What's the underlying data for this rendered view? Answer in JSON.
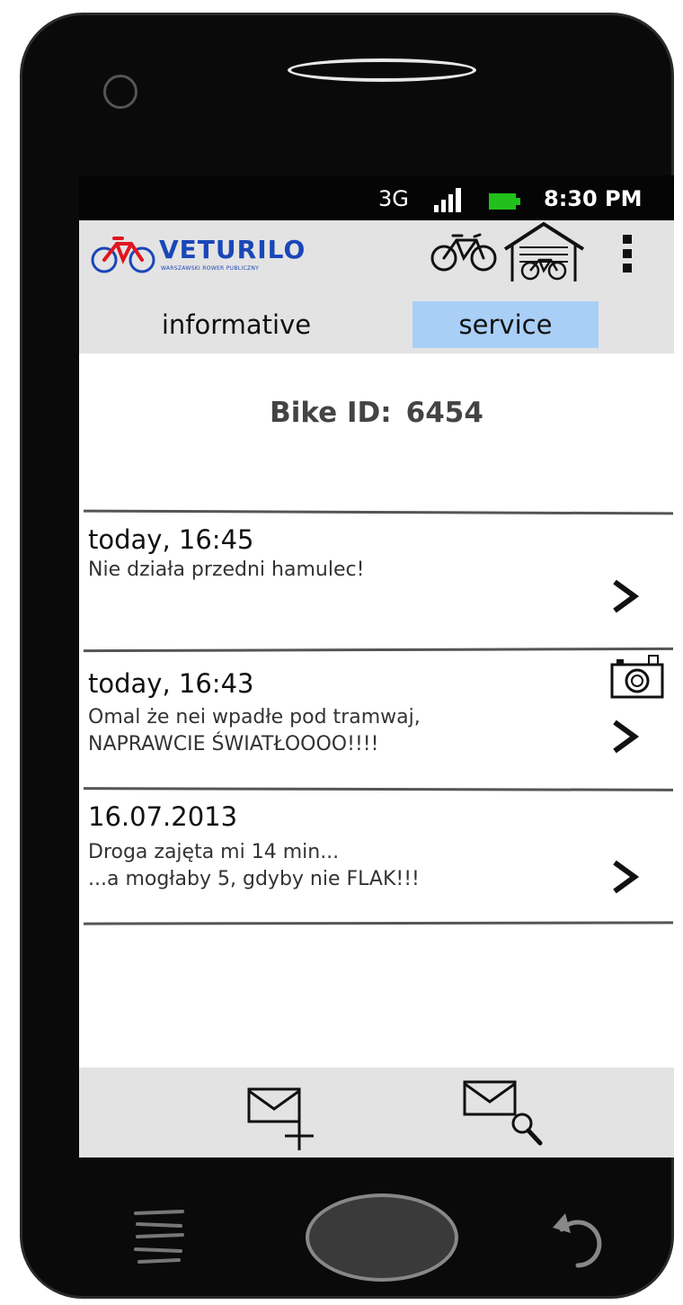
{
  "statusbar": {
    "network": "3G",
    "time": "8:30 PM",
    "battery_color": "#22c01a"
  },
  "appbar": {
    "brand": "VETURILO",
    "brand_sub": "WARSZAWSKI ROWER PUBLICZNY",
    "brand_color": "#1a46b8",
    "bike_icon": "bicycle-icon",
    "garage_icon": "garage-icon",
    "menu_icon": "overflow-menu-icon"
  },
  "tabs": [
    {
      "label": "informative",
      "active": false
    },
    {
      "label": "service",
      "active": true,
      "active_color": "#a9cff7"
    }
  ],
  "bike": {
    "label": "Bike ID:",
    "id": "6454"
  },
  "reports": [
    {
      "date": "today, 16:45",
      "message": "Nie działa przedni hamulec!",
      "has_photo": false
    },
    {
      "date": "today, 16:43",
      "message": "Omal że nei wpadłe pod tramwaj,\nNAPRAWCIE ŚWIATŁOOOO!!!!",
      "has_photo": true
    },
    {
      "date": "16.07.2013",
      "message": "Droga zajęta mi 14 min...\n...a mogłaby 5, gdyby nie FLAK!!!",
      "has_photo": false
    }
  ],
  "bottombar": {
    "compose_icon": "new-message-icon",
    "search_icon": "search-message-icon"
  },
  "navbar": {
    "menu_icon": "menu-icon",
    "home_icon": "home-button",
    "back_icon": "back-icon"
  }
}
